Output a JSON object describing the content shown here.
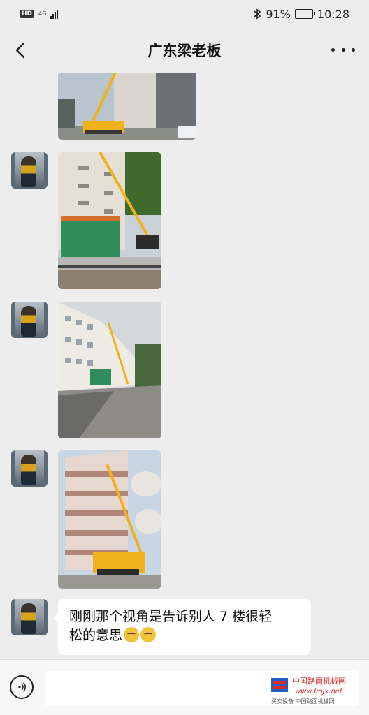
{
  "status": {
    "network_badge": "HD",
    "network_type": "4G",
    "signal_level": 4,
    "battery_percent": "91%",
    "battery_level": 0.91,
    "time": "10:28"
  },
  "nav": {
    "title": "广东梁老板"
  },
  "messages": [
    {
      "type": "image",
      "sender": "other",
      "subject": "crane-beside-building"
    },
    {
      "type": "image",
      "sender": "other",
      "subject": "crane-over-scaffold"
    },
    {
      "type": "image",
      "sender": "other",
      "subject": "crane-behind-building-street"
    },
    {
      "type": "image",
      "sender": "other",
      "subject": "crane-beside-balconies"
    },
    {
      "type": "text",
      "sender": "other",
      "line1": "刚刚那个视角是告诉别人 7 楼很轻",
      "line2": "松的意思"
    }
  ],
  "watermark": {
    "line1": "中国路面机械网",
    "line2": "www.lmjx.net",
    "line3": "买卖设备  中国路面机械网"
  },
  "colors": {
    "background": "#ededed",
    "bubble": "#ffffff",
    "watermark_red": "#e02a2a",
    "crane_yellow": "#f0b21b"
  }
}
